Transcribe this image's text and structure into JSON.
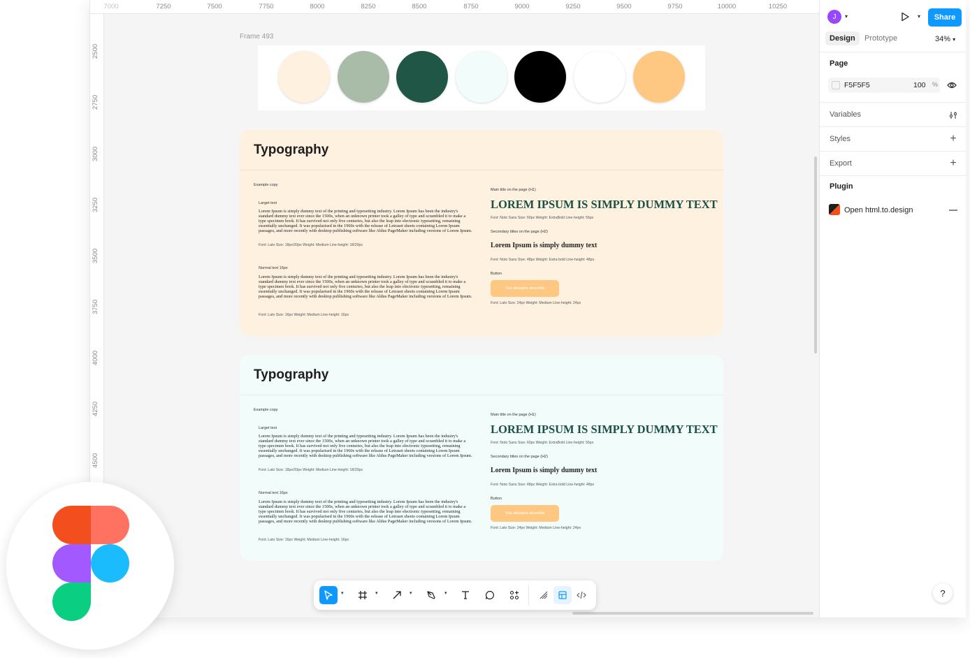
{
  "ruler": {
    "top": [
      "7000",
      "7250",
      "7500",
      "7750",
      "8000",
      "8250",
      "8500",
      "8750",
      "9000",
      "9250",
      "9500",
      "9750",
      "10000",
      "10250"
    ],
    "left": [
      "2500",
      "2750",
      "3000",
      "3250",
      "3500",
      "3750",
      "4000",
      "4250",
      "4500"
    ]
  },
  "canvas": {
    "frame_label": "Frame 493",
    "swatches": [
      "#fef1e0",
      "#a8bca7",
      "#1f5646",
      "#f2fcfb",
      "#000000",
      "#ffffff",
      "#ffc882"
    ],
    "cards": [
      {
        "bg": "#fef1e0",
        "title": "Typography",
        "example_label": "Example copy",
        "large_label": "Larget text",
        "large_para": "Lorem Ipsum is simply dummy text of the printing and typesetting industry. Lorem Ipsum has been the industry's standard dummy text ever since the 1500s, when an unknown printer took a galley of type and scrambled it to make a type specimen book. It has survived not only five centuries, but also the leap into electronic typesetting, remaining essentially unchanged. It was popularised in the 1960s with the release of Letraset sheets containing Lorem Ipsum passages, and more recently with desktop publishing software like Aldus PageMaker including versions of Lorem Ipsum.",
        "large_meta": "Font: Lato   Size: 18px/20px   Weight: Medium   Line-height: 18/20px",
        "normal_label": "Normal text 16px",
        "normal_para": "Lorem Ipsum is simply dummy text of the printing and typesetting industry. Lorem Ipsum has been the industry's standard dummy text ever since the 1500s, when an unknown printer took a galley of type and scrambled it to make a type specimen book. It has survived not only five centuries, but also the leap into electronic typesetting, remaining essentially unchanged. It was popularised in the 1960s with the release of Letraset sheets containing Lorem Ipsum passages, and more recently with desktop publishing software like Aldus PageMaker including versions of Lorem Ipsum.",
        "normal_meta": "Font: Lato   Size: 16px   Weight: Medium   Line-height: 16px",
        "h1_label": "Main title on the page (H1)",
        "h1_text": "LOREM IPSUM IS SIMPLY DUMMY TEXT",
        "h1_meta": "Font: Noto Sans   Size: 60px   Weight: ExtraBold   Line-height: 56px",
        "h2_label": "Secondary titles on the page (H2)",
        "h2_text": "Lorem Ipsum is simply dummy text",
        "h2_meta": "Font: Noto Sans   Size: 48px   Weight: Extra bold   Line-height: 48px",
        "button_label": "Button",
        "button_text": "Vsa aktualna obvestila",
        "button_meta": "Font: Lato   Size: 24px   Weight: Medium   Line-height: 24px"
      },
      {
        "bg": "#f2fcfb",
        "title": "Typography",
        "example_label": "Example copy",
        "large_label": "Larget text",
        "large_para": "Lorem Ipsum is simply dummy text of the printing and typesetting industry. Lorem Ipsum has been the industry's standard dummy text ever since the 1500s, when an unknown printer took a galley of type and scrambled it to make a type specimen book. It has survived not only five centuries, but also the leap into electronic typesetting, remaining essentially unchanged. It was popularised in the 1960s with the release of Letraset sheets containing Lorem Ipsum passages, and more recently with desktop publishing software like Aldus PageMaker including versions of Lorem Ipsum.",
        "large_meta": "Font: Lato   Size: 18px/20px   Weight: Medium   Line-height: 18/20px",
        "normal_label": "Normal text 16px",
        "normal_para": "Lorem Ipsum is simply dummy text of the printing and typesetting industry. Lorem Ipsum has been the industry's standard dummy text ever since the 1500s, when an unknown printer took a galley of type and scrambled it to make a type specimen book. It has survived not only five centuries, but also the leap into electronic typesetting, remaining essentially unchanged. It was popularised in the 1960s with the release of Letraset sheets containing Lorem Ipsum passages, and more recently with desktop publishing software like Aldus PageMaker including versions of Lorem Ipsum.",
        "normal_meta": "Font: Lato   Size: 16px   Weight: Medium   Line-height: 16px",
        "h1_label": "Main title on the page (H1)",
        "h1_text": "LOREM IPSUM IS SIMPLY DUMMY TEXT",
        "h1_meta": "Font: Noto Sans   Size: 60px   Weight: ExtraBold   Line-height: 56px",
        "h2_label": "Secondary titles on the page (H2)",
        "h2_text": "Lorem Ipsum is simply dummy text",
        "h2_meta": "Font: Noto Sans   Size: 48px   Weight: Extra bold   Line-height: 48px",
        "button_label": "Button",
        "button_text": "Vsa aktualna obvestila",
        "button_meta": "Font: Lato   Size: 24px   Weight: Medium   Line-height: 24px"
      }
    ]
  },
  "panel": {
    "avatar_initial": "J",
    "share_label": "Share",
    "tabs": {
      "design": "Design",
      "prototype": "Prototype"
    },
    "zoom": "34%",
    "page": {
      "label": "Page",
      "hex": "F5F5F5",
      "opacity": "100",
      "percent": "%"
    },
    "variables_label": "Variables",
    "styles_label": "Styles",
    "export_label": "Export",
    "plugin": {
      "label": "Plugin",
      "name": "Open html.to.design"
    },
    "help": "?"
  },
  "toolbar": {
    "tools": [
      "move-tool",
      "frame-tool",
      "shape-tool",
      "pen-tool",
      "text-tool",
      "comment-tool",
      "actions-tool",
      "draw-mode",
      "design-mode",
      "dev-mode"
    ]
  },
  "colors": {
    "accent": "#0d99ff",
    "figma_red": "#f24e1e",
    "figma_orange": "#ff7262",
    "figma_purple": "#a259ff",
    "figma_blue": "#1abcfe",
    "figma_green": "#0acf83"
  }
}
